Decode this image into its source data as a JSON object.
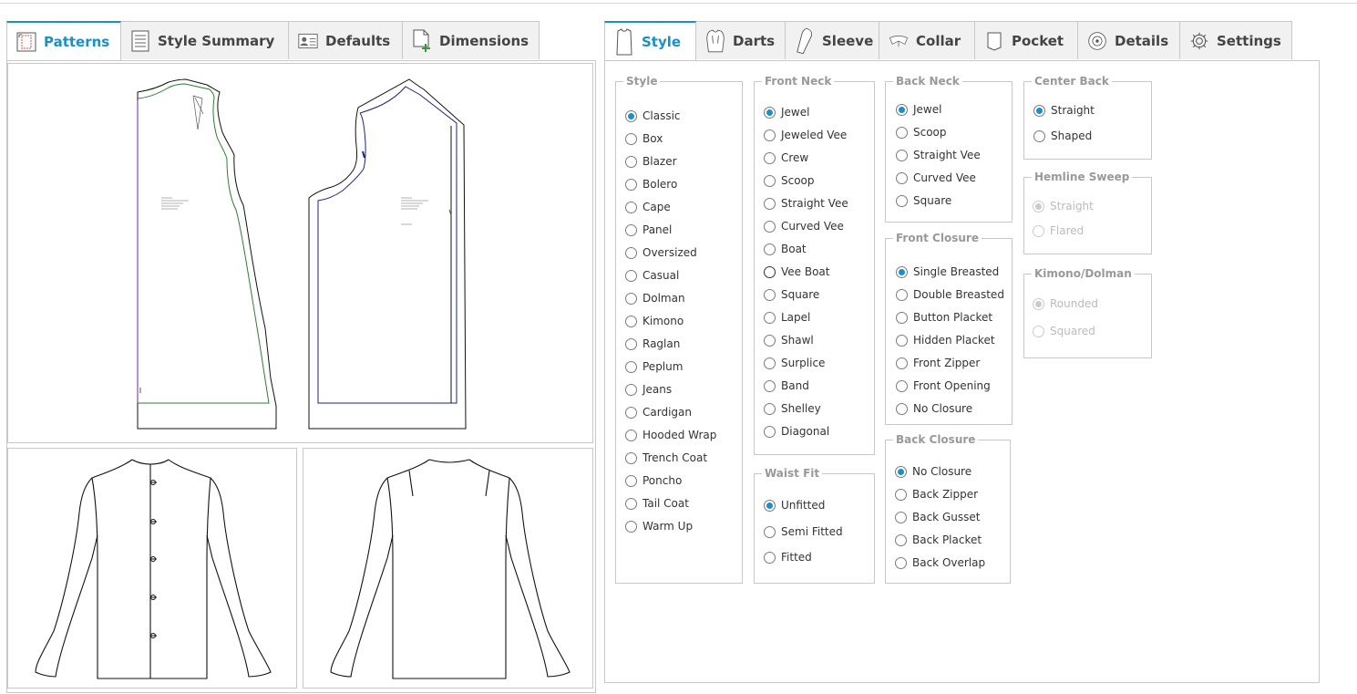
{
  "left_tabs": [
    {
      "label": "Patterns",
      "icon": "patterns-icon",
      "active": true
    },
    {
      "label": "Style Summary",
      "icon": "style-summary-icon",
      "active": false
    },
    {
      "label": "Defaults",
      "icon": "defaults-icon",
      "active": false
    },
    {
      "label": "Dimensions",
      "icon": "dimensions-icon",
      "active": false
    }
  ],
  "right_tabs": [
    {
      "label": "Style",
      "icon": "shirt-icon",
      "active": true
    },
    {
      "label": "Darts",
      "icon": "darts-icon",
      "active": false
    },
    {
      "label": "Sleeve",
      "icon": "sleeve-icon",
      "active": false
    },
    {
      "label": "Collar",
      "icon": "collar-icon",
      "active": false
    },
    {
      "label": "Pocket",
      "icon": "pocket-icon",
      "active": false
    },
    {
      "label": "Details",
      "icon": "details-icon",
      "active": false
    },
    {
      "label": "Settings",
      "icon": "gear-icon",
      "active": false
    }
  ],
  "colors": {
    "accent": "#1a8fc9",
    "border": "#c8c8c8",
    "legend": "#999999",
    "front_seam": "#2e7d32",
    "back_seam": "#1a237e",
    "center_line": "#7b1fa2"
  },
  "groups": {
    "style": {
      "legend": "Style",
      "selected": "Classic",
      "options": [
        "Classic",
        "Box",
        "Blazer",
        "Bolero",
        "Cape",
        "Panel",
        "Oversized",
        "Casual",
        "Dolman",
        "Kimono",
        "Raglan",
        "Peplum",
        "Jeans",
        "Cardigan",
        "Hooded Wrap",
        "Trench Coat",
        "Poncho",
        "Tail Coat",
        "Warm Up"
      ]
    },
    "front_neck": {
      "legend": "Front Neck",
      "selected": "Jewel",
      "focused": "Vee Boat",
      "options": [
        "Jewel",
        "Jeweled Vee",
        "Crew",
        "Scoop",
        "Straight Vee",
        "Curved Vee",
        "Boat",
        "Vee Boat",
        "Square",
        "Lapel",
        "Shawl",
        "Surplice",
        "Band",
        "Shelley",
        "Diagonal"
      ]
    },
    "waist_fit": {
      "legend": "Waist Fit",
      "selected": "Unfitted",
      "options": [
        "Unfitted",
        "Semi Fitted",
        "Fitted"
      ]
    },
    "back_neck": {
      "legend": "Back Neck",
      "selected": "Jewel",
      "options": [
        "Jewel",
        "Scoop",
        "Straight Vee",
        "Curved Vee",
        "Square"
      ]
    },
    "front_closure": {
      "legend": "Front Closure",
      "selected": "Single Breasted",
      "options": [
        "Single Breasted",
        "Double Breasted",
        "Button Placket",
        "Hidden Placket",
        "Front Zipper",
        "Front Opening",
        "No Closure"
      ]
    },
    "back_closure": {
      "legend": "Back Closure",
      "selected": "No Closure",
      "options": [
        "No Closure",
        "Back Zipper",
        "Back Gusset",
        "Back Placket",
        "Back Overlap"
      ]
    },
    "center_back": {
      "legend": "Center Back",
      "selected": "Straight",
      "options": [
        "Straight",
        "Shaped"
      ]
    },
    "hemline_sweep": {
      "legend": "Hemline Sweep",
      "selected": "Straight",
      "disabled": true,
      "options": [
        "Straight",
        "Flared"
      ]
    },
    "kimono_dolman": {
      "legend": "Kimono/Dolman",
      "selected": "Rounded",
      "disabled": true,
      "options": [
        "Rounded",
        "Squared"
      ]
    }
  }
}
